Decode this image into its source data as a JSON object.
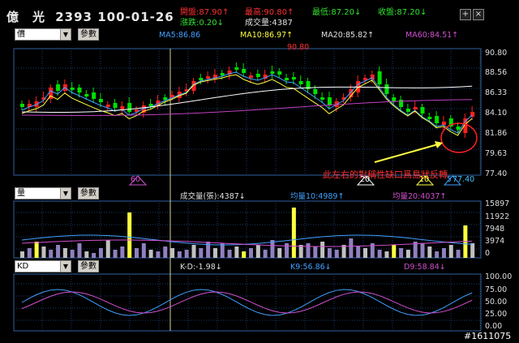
{
  "header": {
    "stock_name": "億　光",
    "code_date": "2393 100-01-26",
    "open": "開盤:87.90↑",
    "high": "最高:90.80↑",
    "low": "最低:87.20↓",
    "close": "收盤:87.20↓",
    "change": "漲跌:0.20↓",
    "volume": "成交量:4387",
    "zoom_in": "+",
    "close_btn": "×"
  },
  "price_panel": {
    "select_value": "價",
    "params_button": "參數",
    "ma5": "MA5:86.86",
    "ma10": "MA10:86.97↑",
    "ma20": "MA20:85.82↑",
    "ma60": "MA60:84.51↑",
    "peak_label": "90.80",
    "low_label": "77.40",
    "axis_ticks": [
      "90.80",
      "88.56",
      "86.33",
      "84.10",
      "81.86",
      "79.63",
      "77.40"
    ],
    "annotation": "此左右的對稱性缺口爲島狀反轉",
    "markers": [
      "60",
      "20",
      "10",
      "5"
    ]
  },
  "volume_panel": {
    "select_value": "量",
    "params_button": "參數",
    "volume": "成交量(張):4387↓",
    "avg10": "均量10:4989↑",
    "avg20": "均量20:4037↑",
    "axis_ticks": [
      "15897",
      "11922",
      "7948",
      "3974",
      "0"
    ]
  },
  "kd_panel": {
    "select_value": "KD",
    "params_button": "參數",
    "kd_diff": "K-D:-1.98↓",
    "k9": "K9:56.86↓",
    "d9": "D9:58.84↓",
    "axis_ticks": [
      "100.00",
      "75.00",
      "50.00",
      "25.00",
      "0.00"
    ]
  },
  "watermark": "#1611075",
  "colors": {
    "up": "#ff2020",
    "down": "#00e000",
    "ma5": "#ffffff",
    "ma10": "#ffff40",
    "ma60": "#c040c0",
    "grid": "#1a3a6a",
    "volume_up": "#ffff40",
    "volume_other": "#c0c0c0",
    "volume_purple": "#9080c0"
  }
}
